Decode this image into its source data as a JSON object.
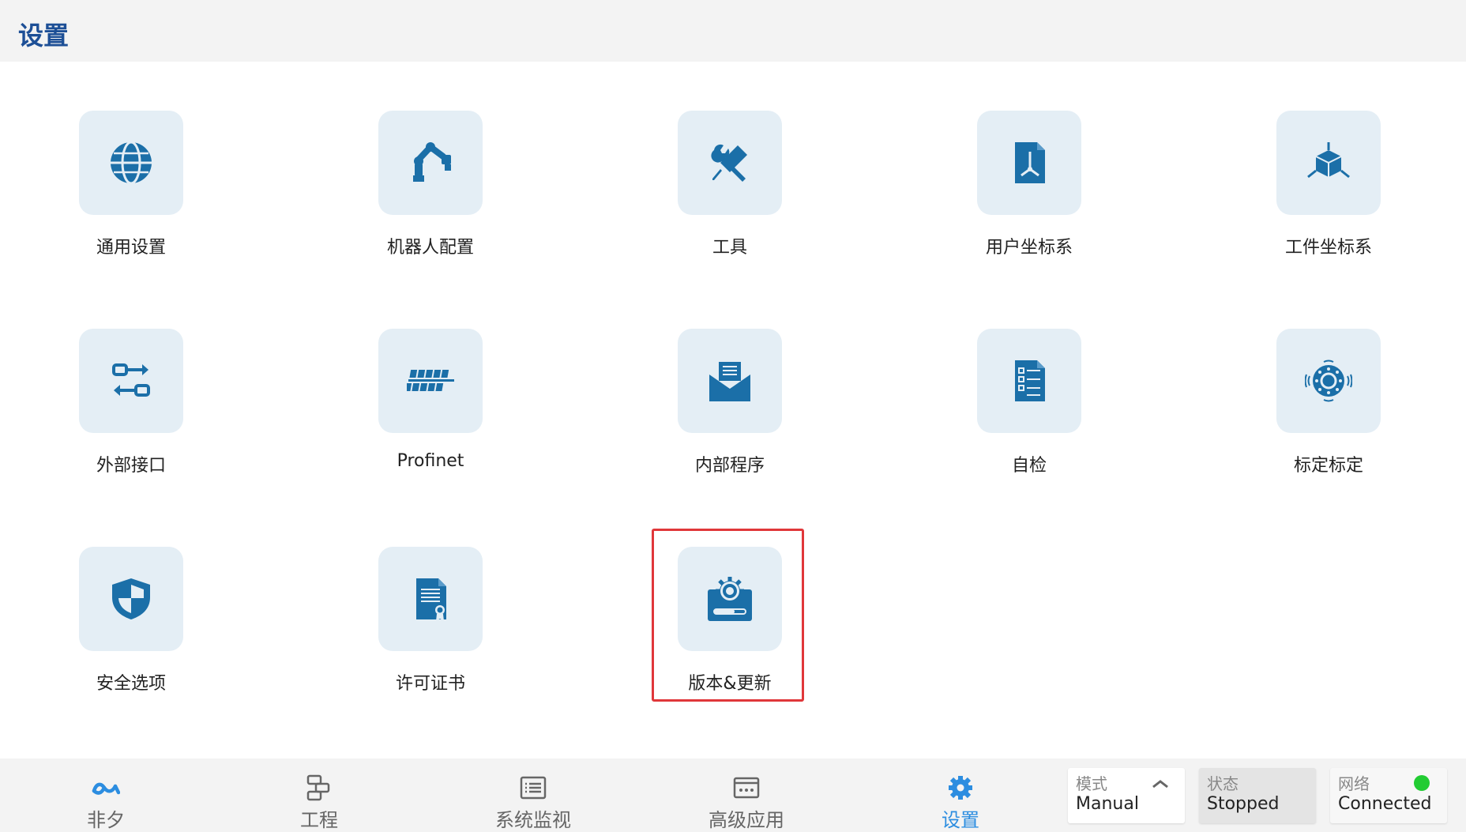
{
  "header": {
    "title": "设置"
  },
  "tiles": [
    {
      "label": "通用设置",
      "icon": "globe-icon"
    },
    {
      "label": "机器人配置",
      "icon": "robot-arm-icon"
    },
    {
      "label": "工具",
      "icon": "tools-icon"
    },
    {
      "label": "用户坐标系",
      "icon": "user-frame-icon"
    },
    {
      "label": "工件坐标系",
      "icon": "workpiece-frame-icon"
    },
    {
      "label": "外部接口",
      "icon": "io-interface-icon"
    },
    {
      "label": "Profinet",
      "icon": "profinet-icon"
    },
    {
      "label": "内部程序",
      "icon": "mail-program-icon"
    },
    {
      "label": "自检",
      "icon": "checklist-icon"
    },
    {
      "label": "标定标定",
      "icon": "calibration-icon"
    },
    {
      "label": "安全选项",
      "icon": "shield-icon"
    },
    {
      "label": "许可证书",
      "icon": "certificate-icon"
    },
    {
      "label": "版本&更新",
      "icon": "update-gear-icon"
    }
  ],
  "nav": [
    {
      "label": "非夕",
      "icon": "flexiv-logo-icon"
    },
    {
      "label": "工程",
      "icon": "project-icon"
    },
    {
      "label": "系统监视",
      "icon": "monitor-icon"
    },
    {
      "label": "高级应用",
      "icon": "advanced-app-icon"
    },
    {
      "label": "设置",
      "icon": "settings-gear-icon",
      "active": true
    }
  ],
  "status": {
    "mode": {
      "label": "模式",
      "value": "Manual"
    },
    "state": {
      "label": "状态",
      "value": "Stopped"
    },
    "network": {
      "label": "网络",
      "value": "Connected",
      "indicator": "#22cc33"
    }
  },
  "colors": {
    "accent": "#2c8de0",
    "icon": "#1b6fa8",
    "highlight": "#e0373a",
    "title": "#1d4f96"
  }
}
